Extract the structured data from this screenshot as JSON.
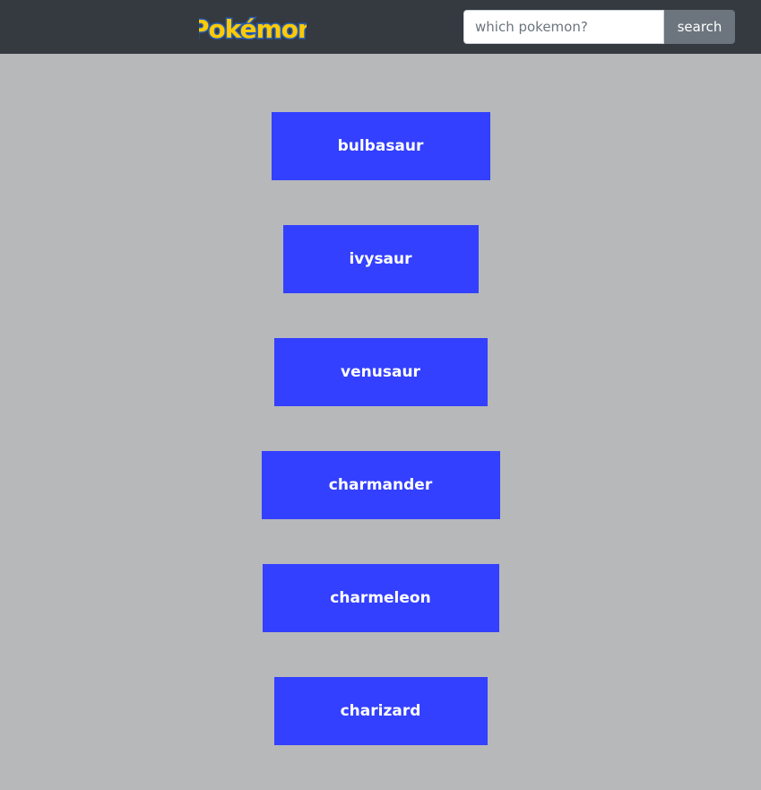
{
  "header": {
    "logo_text": "Pokémon",
    "search": {
      "placeholder": "which pokemon?",
      "value": "",
      "button_label": "search"
    }
  },
  "pokemon": [
    {
      "name": "bulbasaur"
    },
    {
      "name": "ivysaur"
    },
    {
      "name": "venusaur"
    },
    {
      "name": "charmander"
    },
    {
      "name": "charmeleon"
    },
    {
      "name": "charizard"
    }
  ],
  "colors": {
    "navbar": "#343a40",
    "page_background": "#b7b8ba",
    "item_background": "#3340ff",
    "item_text": "#ffffff",
    "search_button": "#6c757d",
    "logo_yellow": "#ffcb05",
    "logo_blue": "#2a5db0"
  }
}
